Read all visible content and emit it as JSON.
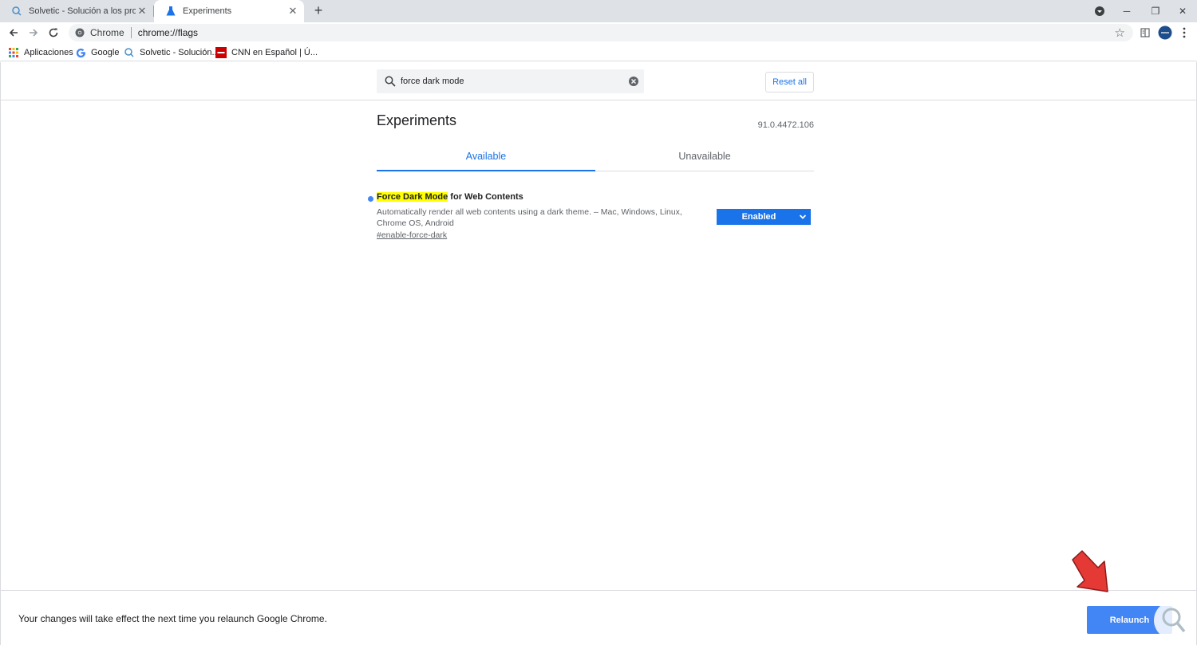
{
  "browser": {
    "tabs": [
      {
        "title": "Solvetic - Solución a los problem",
        "close": "✕",
        "active": false
      },
      {
        "title": "Experiments",
        "close": "✕",
        "active": true
      }
    ],
    "new_tab": "+",
    "window_controls": {
      "minimize": "─",
      "restore": "❐",
      "close": "✕"
    }
  },
  "toolbar": {
    "scheme_label": "Chrome",
    "url": "chrome://flags",
    "star": "☆"
  },
  "bookmarks": [
    {
      "label": "Aplicaciones",
      "icon": "apps-grid-icon"
    },
    {
      "label": "Google",
      "icon": "google-icon"
    },
    {
      "label": "Solvetic - Solución...",
      "icon": "solvetic-icon"
    },
    {
      "label": "CNN en Español | Ú...",
      "icon": "cnn-icon"
    }
  ],
  "search": {
    "value": "force dark mode",
    "reset_label": "Reset all"
  },
  "page": {
    "title": "Experiments",
    "version": "91.0.4472.106",
    "tabs": [
      {
        "label": "Available",
        "active": true
      },
      {
        "label": "Unavailable",
        "active": false
      }
    ]
  },
  "flag": {
    "name_highlight": "Force Dark Mode",
    "name_rest": " for Web Contents",
    "description": "Automatically render all web contents using a dark theme. – Mac, Windows, Linux, Chrome OS, Android",
    "link": "#enable-force-dark",
    "selected_option": "Enabled"
  },
  "footer": {
    "message": "Your changes will take effect the next time you relaunch Google Chrome.",
    "relaunch_label": "Relaunch"
  },
  "colors": {
    "accent": "#1a73e8",
    "relaunch": "#4285f4",
    "highlight": "#ffff00",
    "arrow": "#e53935"
  }
}
